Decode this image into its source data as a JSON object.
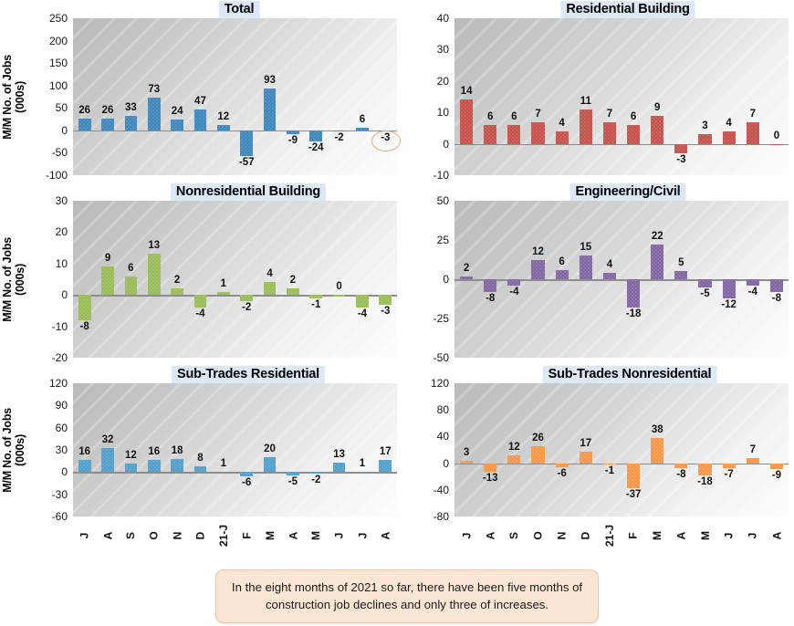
{
  "caption": {
    "text": "In the eight months of 2021 so far, there have been five months of construction job declines and only three of increases."
  },
  "axis": {
    "ylabel": "M/M No. of Jobs (000s)",
    "ylabel_line1": "M/M No. of Jobs",
    "ylabel_line2": "(000s)"
  },
  "colors": {
    "total": "#3b86bd",
    "residential": "#c4504a",
    "nonresidential": "#97bb55",
    "engineering": "#8064a2",
    "subtrades_residential": "#4f9ecb",
    "subtrades_nonresidential": "#f79646",
    "title_bg": "#dde8f6",
    "caption_bg": "#fbe6d4",
    "annotation_ellipse": "#e8a882",
    "zero_line": "#8d8d8d"
  },
  "annotations": [
    {
      "panel": 0,
      "type": "ellipse",
      "target_category": "A",
      "target_value": -3,
      "label": "-3"
    }
  ],
  "chart_data": [
    {
      "type": "bar",
      "title": "Total",
      "xlabel": "",
      "ylabel": "M/M No. of Jobs (000s)",
      "categories": [
        "J",
        "A",
        "S",
        "O",
        "N",
        "D",
        "21-J",
        "F",
        "M",
        "A",
        "M",
        "J",
        "J",
        "A"
      ],
      "values": [
        26,
        26,
        33,
        73,
        24,
        47,
        12,
        -57,
        93,
        -9,
        -24,
        -2,
        6,
        -3
      ],
      "ylim": [
        -100,
        250
      ],
      "yticks": [
        250,
        200,
        150,
        100,
        50,
        0,
        -50,
        -100
      ],
      "color": "#3b86bd",
      "grid": false,
      "legend": "none"
    },
    {
      "type": "bar",
      "title": "Residential Building",
      "xlabel": "",
      "ylabel": "",
      "categories": [
        "J",
        "A",
        "S",
        "O",
        "N",
        "D",
        "21-J",
        "F",
        "M",
        "A",
        "M",
        "J",
        "J",
        "A"
      ],
      "values": [
        14,
        6,
        6,
        7,
        4,
        11,
        7,
        6,
        9,
        -3,
        3,
        4,
        7,
        0
      ],
      "ylim": [
        -10,
        40
      ],
      "yticks": [
        40,
        30,
        20,
        10,
        0,
        -10
      ],
      "color": "#c4504a",
      "grid": false,
      "legend": "none"
    },
    {
      "type": "bar",
      "title": "Nonresidential Building",
      "xlabel": "",
      "ylabel": "M/M No. of Jobs (000s)",
      "categories": [
        "J",
        "A",
        "S",
        "O",
        "N",
        "D",
        "21-J",
        "F",
        "M",
        "A",
        "M",
        "J",
        "J",
        "A"
      ],
      "values": [
        -8,
        9,
        6,
        13,
        2,
        -4,
        1,
        -2,
        4,
        2,
        -1,
        0,
        -4,
        -3
      ],
      "ylim": [
        -20,
        30
      ],
      "yticks": [
        30,
        20,
        10,
        0,
        -10,
        -20
      ],
      "color": "#97bb55",
      "grid": false,
      "legend": "none"
    },
    {
      "type": "bar",
      "title": "Engineering/Civil",
      "xlabel": "",
      "ylabel": "",
      "categories": [
        "J",
        "A",
        "S",
        "O",
        "N",
        "D",
        "21-J",
        "F",
        "M",
        "A",
        "M",
        "J",
        "J",
        "A"
      ],
      "values": [
        2,
        -8,
        -4,
        12,
        6,
        15,
        4,
        -18,
        22,
        5,
        -5,
        -12,
        -4,
        -8
      ],
      "ylim": [
        -50,
        50
      ],
      "yticks": [
        50,
        25,
        0,
        -25,
        -50
      ],
      "color": "#8064a2",
      "grid": false,
      "legend": "none"
    },
    {
      "type": "bar",
      "title": "Sub-Trades Residential",
      "xlabel": "",
      "ylabel": "M/M No. of Jobs (000s)",
      "categories": [
        "J",
        "A",
        "S",
        "O",
        "N",
        "D",
        "21-J",
        "F",
        "M",
        "A",
        "M",
        "J",
        "J",
        "A"
      ],
      "values": [
        16,
        32,
        12,
        16,
        18,
        8,
        1,
        -6,
        20,
        -5,
        -2,
        13,
        1,
        17
      ],
      "ylim": [
        -60,
        120
      ],
      "yticks": [
        120,
        90,
        60,
        30,
        0,
        -30,
        -60
      ],
      "color": "#4f9ecb",
      "grid": false,
      "legend": "none"
    },
    {
      "type": "bar",
      "title": "Sub-Trades Nonresidential",
      "xlabel": "",
      "ylabel": "",
      "categories": [
        "J",
        "A",
        "S",
        "O",
        "N",
        "D",
        "21-J",
        "F",
        "M",
        "A",
        "M",
        "J",
        "J",
        "A"
      ],
      "values": [
        3,
        -13,
        12,
        26,
        -6,
        17,
        -1,
        -37,
        38,
        -8,
        -18,
        -7,
        7,
        -9
      ],
      "ylim": [
        -80,
        120
      ],
      "yticks": [
        120,
        80,
        40,
        0,
        -40,
        -80
      ],
      "color": "#f79646",
      "grid": false,
      "legend": "none"
    }
  ]
}
